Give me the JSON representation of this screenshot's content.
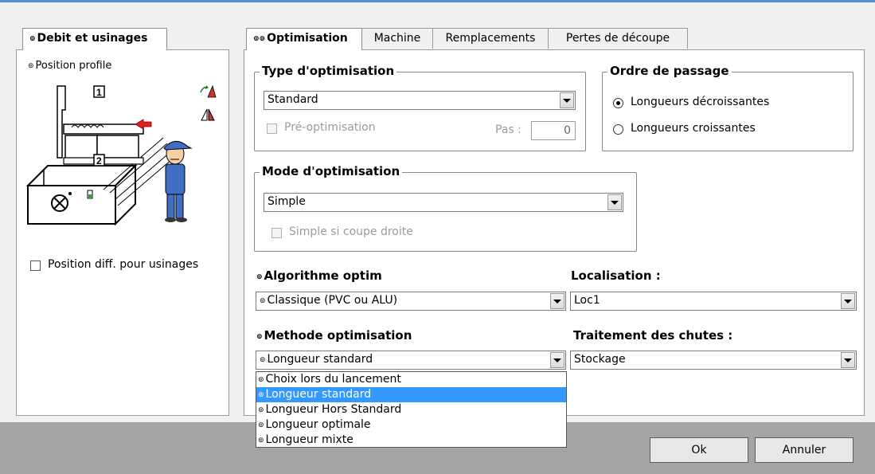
{
  "left_tab": {
    "title": "Debit et usinages",
    "position_profile_label": "Position profile",
    "marker_1": "1",
    "marker_2": "2",
    "diff_position_label": "Position diff. pour usinages"
  },
  "tabs": [
    {
      "label": "Optimisation",
      "active": true
    },
    {
      "label": "Machine",
      "active": false
    },
    {
      "label": "Remplacements",
      "active": false
    },
    {
      "label": "Pertes de découpe",
      "active": false
    }
  ],
  "type_optim": {
    "title": "Type d'optimisation",
    "combo_value": "Standard",
    "pre_optim_label": "Pré-optimisation",
    "pas_label": "Pas :",
    "pas_value": "0"
  },
  "ordre": {
    "title": "Ordre de passage",
    "option1": "Longueurs décroissantes",
    "option2": "Longueurs croissantes",
    "selected": "Longueurs décroissantes"
  },
  "mode": {
    "title": "Mode d'optimisation",
    "combo_value": "Simple",
    "simple_droite_label": "Simple si coupe droite"
  },
  "algo": {
    "title": "Algorithme optim",
    "combo_value": "Classique (PVC ou ALU)"
  },
  "localisation": {
    "title": "Localisation :",
    "combo_value": "Loc1"
  },
  "methode": {
    "title": "Methode optimisation",
    "combo_value": "Longueur standard",
    "options": [
      "Choix lors du lancement",
      "Longueur standard",
      "Longueur Hors Standard",
      "Longueur optimale",
      "Longueur mixte"
    ],
    "highlighted_index": 1
  },
  "traitement": {
    "title": "Traitement des chutes :",
    "combo_value": "Stockage"
  },
  "buttons": {
    "ok": "Ok",
    "cancel": "Annuler"
  },
  "colors": {
    "selection": "#3399ff",
    "footer": "#a4a4a4",
    "accent_red": "#e02020"
  }
}
